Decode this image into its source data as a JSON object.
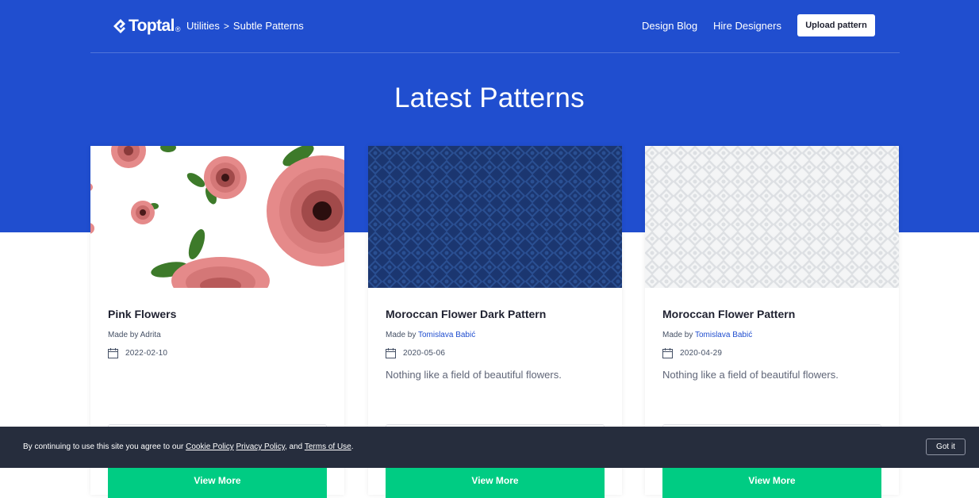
{
  "header": {
    "logo_text": "Toptal",
    "logo_trademark": "®",
    "breadcrumbs": [
      {
        "label": "Utilities"
      },
      {
        "label": "Subtle Patterns"
      }
    ],
    "breadcrumb_separator": ">",
    "nav": [
      {
        "label": "Design Blog"
      },
      {
        "label": "Hire Designers"
      }
    ],
    "upload_label": "Upload pattern"
  },
  "page_title": "Latest Patterns",
  "made_by_prefix": "Made by ",
  "cards": [
    {
      "title": "Pink Flowers",
      "author": "Adrita",
      "date": "2022-02-10",
      "description": "",
      "button": "View More",
      "thumbnail": "pink-flowers-pattern"
    },
    {
      "title": "Moroccan Flower Dark Pattern",
      "author": "Tomislava Babić",
      "date": "2020-05-06",
      "description": "Nothing like a field of beautiful flowers.",
      "button": "View More",
      "thumbnail": "moroccan-dark-pattern"
    },
    {
      "title": "Moroccan Flower Pattern",
      "author": "Tomislava Babić",
      "date": "2020-04-29",
      "description": "Nothing like a field of beautiful flowers.",
      "button": "View More",
      "thumbnail": "moroccan-light-pattern"
    }
  ],
  "cookie_banner": {
    "text_before": "By continuing to use this site you agree to our ",
    "cookie_policy": "Cookie Policy",
    "privacy_policy": "Privacy Policy",
    "and_text": ", and ",
    "terms": "Terms of Use",
    "period": ".",
    "got_it": "Got it"
  },
  "colors": {
    "brand_blue": "#204ecf",
    "cta_green": "#00cc83",
    "banner_dark": "#262d3d",
    "link_blue": "#204ecf"
  },
  "icons": [
    "toptal-logo-icon",
    "chevron-right-icon",
    "calendar-icon"
  ]
}
